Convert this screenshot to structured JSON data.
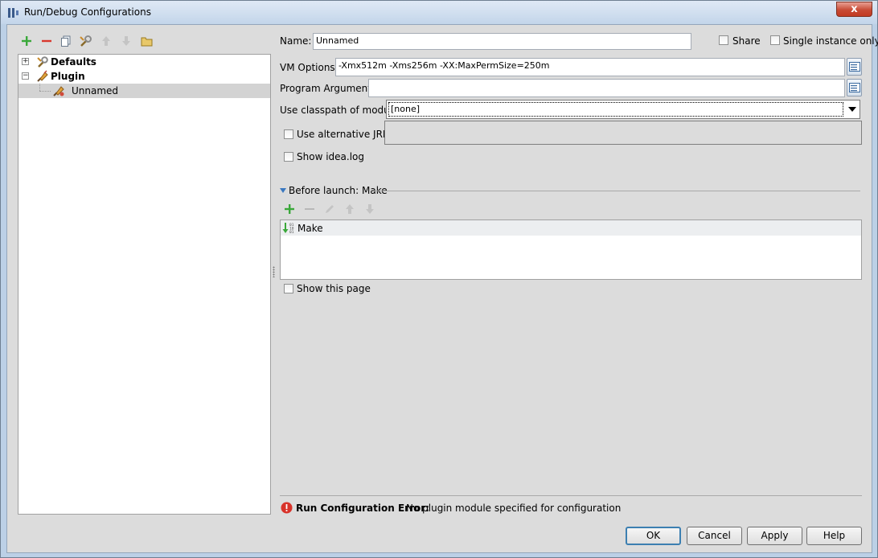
{
  "window": {
    "title": "Run/Debug Configurations",
    "close_label": "x"
  },
  "toolbar": {
    "icons": [
      "add-icon",
      "remove-icon",
      "copy-icon",
      "edit-defaults-icon",
      "move-up-icon",
      "move-down-icon",
      "folder-icon"
    ]
  },
  "tree": {
    "items": [
      {
        "label": "Defaults",
        "expander": "+"
      },
      {
        "label": "Plugin",
        "expander": "−"
      },
      {
        "label": "Unnamed"
      }
    ]
  },
  "form": {
    "name_label": "Name:",
    "name_value": "Unnamed",
    "share_label": "Share",
    "single_instance_label": "Single instance only",
    "vm_options_label": "VM Options:",
    "vm_options_value": "-Xmx512m -Xms256m -XX:MaxPermSize=250m",
    "program_args_label": "Program Arguments:",
    "program_args_value": "",
    "classpath_label": "Use classpath of module:",
    "classpath_value": "[none]",
    "alt_jre_label": "Use alternative JRE:",
    "show_idea_log_label": "Show idea.log"
  },
  "before_launch": {
    "header": "Before launch: Make",
    "items": [
      "Make"
    ],
    "show_this_page_label": "Show this page"
  },
  "error": {
    "title": "Run Configuration Error:",
    "message": "No plugin module specified for configuration"
  },
  "buttons": {
    "ok": "OK",
    "cancel": "Cancel",
    "apply": "Apply",
    "help": "Help"
  },
  "colors": {
    "accent_green": "#3aa83a",
    "remove_red": "#d9382e",
    "error_red": "#d8332a",
    "default_button_border": "#3c7fb1"
  }
}
